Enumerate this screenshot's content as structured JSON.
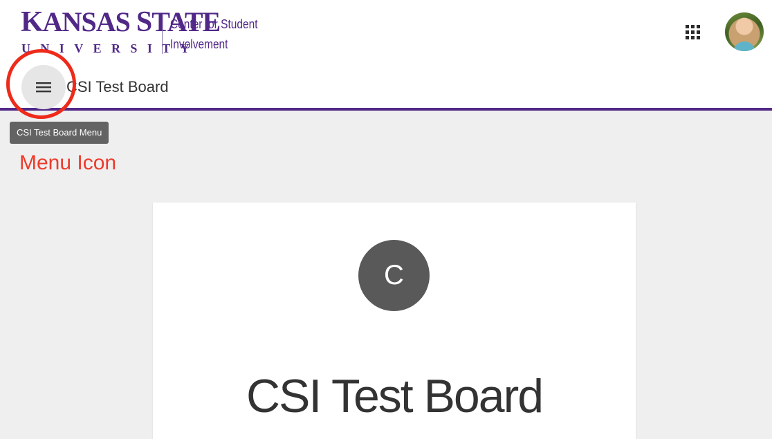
{
  "header": {
    "logo": {
      "name_first_letter_k": "K",
      "name_rest_1": "ANSAS ",
      "name_first_letter_s": "S",
      "name_rest_2": "TATE",
      "university": "UNIVERSITY",
      "sub_line1": "Center for Student",
      "sub_line2": "Involvement"
    },
    "apps_icon": "grid-icon",
    "avatar": "user-avatar-photo",
    "brand_color": "#512888"
  },
  "toolbar": {
    "menu_icon": "hamburger-menu-icon",
    "board_title": "CSI Test Board",
    "tooltip": "CSI Test Board Menu"
  },
  "annotation": {
    "label": "Menu Icon",
    "color": "#ee2a1a"
  },
  "card": {
    "avatar_letter": "C",
    "title": "CSI Test Board"
  }
}
